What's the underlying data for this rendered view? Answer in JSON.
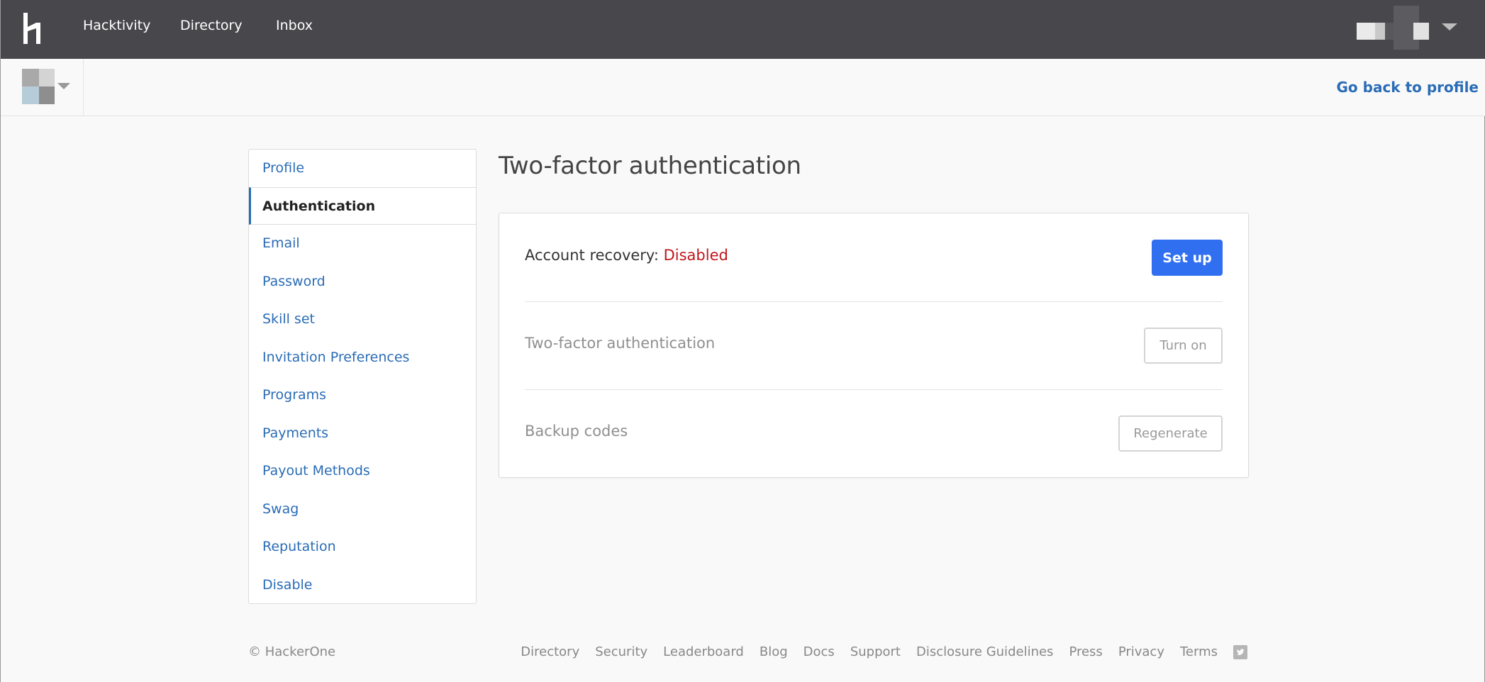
{
  "topnav": {
    "links": [
      "Hacktivity",
      "Directory",
      "Inbox"
    ]
  },
  "subheader": {
    "back_link": "Go back to profile"
  },
  "sidebar": {
    "items": [
      {
        "label": "Profile",
        "active": false
      },
      {
        "label": "Authentication",
        "active": true
      },
      {
        "label": "Email",
        "active": false
      },
      {
        "label": "Password",
        "active": false
      },
      {
        "label": "Skill set",
        "active": false
      },
      {
        "label": "Invitation Preferences",
        "active": false
      },
      {
        "label": "Programs",
        "active": false
      },
      {
        "label": "Payments",
        "active": false
      },
      {
        "label": "Payout Methods",
        "active": false
      },
      {
        "label": "Swag",
        "active": false
      },
      {
        "label": "Reputation",
        "active": false
      },
      {
        "label": "Disable",
        "active": false
      }
    ]
  },
  "main": {
    "title": "Two-factor authentication",
    "rows": {
      "recovery": {
        "label": "Account recovery:",
        "status": "Disabled",
        "button": "Set up"
      },
      "twofa": {
        "label": "Two-factor authentication",
        "button": "Turn on"
      },
      "backup": {
        "label": "Backup codes",
        "button": "Regenerate"
      }
    }
  },
  "footer": {
    "copyright": "© HackerOne",
    "links": [
      "Directory",
      "Security",
      "Leaderboard",
      "Blog",
      "Docs",
      "Support",
      "Disclosure Guidelines",
      "Press",
      "Privacy",
      "Terms"
    ]
  },
  "colors": {
    "nav_bg": "#48474c",
    "link": "#2a6cb6",
    "primary_button": "#2f6ff0",
    "disabled_status": "#c0161c"
  }
}
